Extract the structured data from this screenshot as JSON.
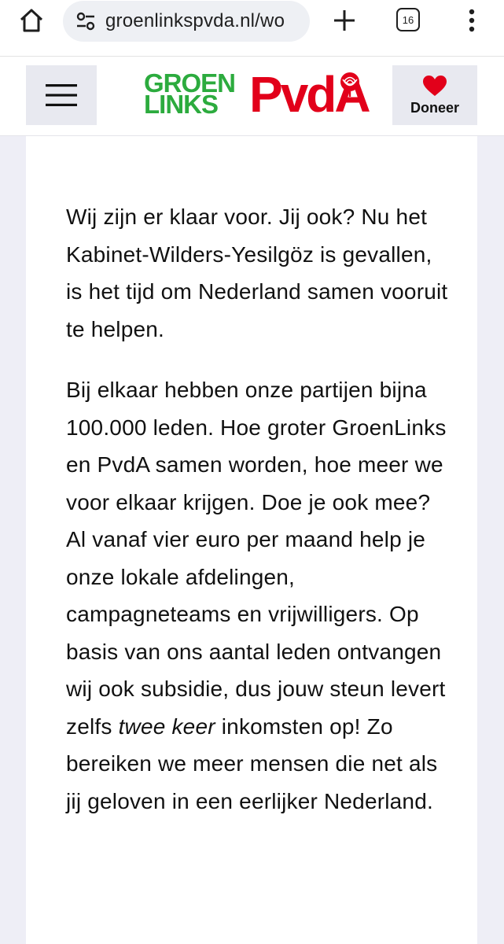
{
  "browser": {
    "url_text": "groenlinkspvda.nl/wo",
    "tab_count": "16",
    "icons": [
      "home-icon",
      "site-settings-icon",
      "new-tab-icon",
      "tab-switcher-icon",
      "more-vert-icon"
    ]
  },
  "header": {
    "logo": {
      "line1": "GROEN",
      "line2": "LINKS",
      "pvda": "PvdA"
    },
    "donate_label": "Doneer",
    "colors": {
      "green": "#2cab3e",
      "red": "#e2001a",
      "button_bg": "#e8e9f0"
    }
  },
  "article": {
    "paragraph1": "Wij zijn er klaar voor. Jij ook? Nu het Kabinet-Wilders-Yesilgöz is gevallen, is het tijd om Nederland samen vooruit te helpen.",
    "paragraph2_before": "Bij elkaar hebben onze partijen bijna 100.000 leden. Hoe groter GroenLinks en PvdA samen worden, hoe meer we voor elkaar krijgen. Doe je ook mee? Al vanaf vier euro per maand help je onze lokale afdelingen, campagneteams en vrijwilligers. Op basis van ons aantal leden ontvangen wij ook subsidie, dus jouw steun levert zelfs ",
    "paragraph2_emphasis": "twee keer",
    "paragraph2_after": " inkomsten op! Zo bereiken we meer mensen die net als jij geloven in een eerlijker Nederland."
  }
}
